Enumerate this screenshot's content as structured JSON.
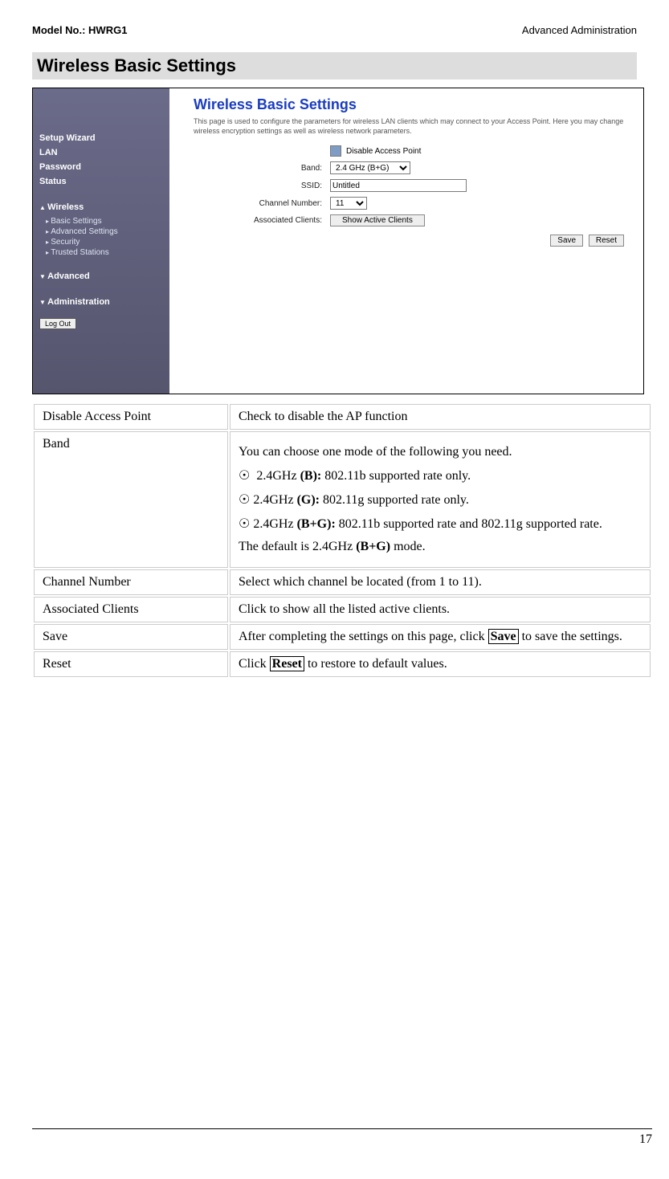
{
  "header": {
    "model": "Model No.: HWRG1",
    "section": "Advanced Administration"
  },
  "heading": "Wireless Basic Settings",
  "screenshot": {
    "title": "Wireless Basic Settings",
    "desc": "This page is used to configure the parameters for wireless LAN clients which may connect to your Access Point. Here you may change wireless encryption settings as well as wireless network parameters.",
    "sidebar": {
      "items": [
        "Setup Wizard",
        "LAN",
        "Password",
        "Status"
      ],
      "wireless_label": "Wireless",
      "wireless_subs": [
        "Basic Settings",
        "Advanced Settings",
        "Security",
        "Trusted Stations"
      ],
      "advanced_label": "Advanced",
      "admin_label": "Administration",
      "logout": "Log Out"
    },
    "form": {
      "disable_ap_label": "Disable Access Point",
      "band_label": "Band:",
      "band_value": "2.4 GHz (B+G)",
      "ssid_label": "SSID:",
      "ssid_value": "Untitled",
      "channel_label": "Channel Number:",
      "channel_value": "11",
      "assoc_label": "Associated Clients:",
      "assoc_btn": "Show Active Clients",
      "save_btn": "Save",
      "reset_btn": "Reset"
    }
  },
  "table": {
    "rows": [
      {
        "label": "Disable Access Point",
        "text": "Check to disable the AP function"
      },
      {
        "label": "Band",
        "text_intro": "You can choose one mode of the following you need.",
        "b1_pre": "2.4GHz ",
        "b1_bold": "(B):",
        "b1_post": " 802.11b supported rate only.",
        "b2_pre": "2.4GHz ",
        "b2_bold": "(G):",
        "b2_post": " 802.11g supported rate only.",
        "b3_pre": "2.4GHz ",
        "b3_bold": "(B+G):",
        "b3_post": " 802.11b supported rate and 802.11g supported rate.",
        "default_pre": "The default is  2.4GHz ",
        "default_bold": "(B+G)",
        "default_post": " mode."
      },
      {
        "label": "Channel Number",
        "text": "Select which channel be located (from 1 to 11)."
      },
      {
        "label": "Associated Clients",
        "text": "Click to show all the listed active clients."
      },
      {
        "label": "Save",
        "pre": "After completing the settings on this page, click ",
        "box": "Save",
        "post": " to save the settings."
      },
      {
        "label": "Reset",
        "pre": "Click ",
        "box": "Reset",
        "post": " to restore to default values."
      }
    ]
  },
  "page_number": "17"
}
